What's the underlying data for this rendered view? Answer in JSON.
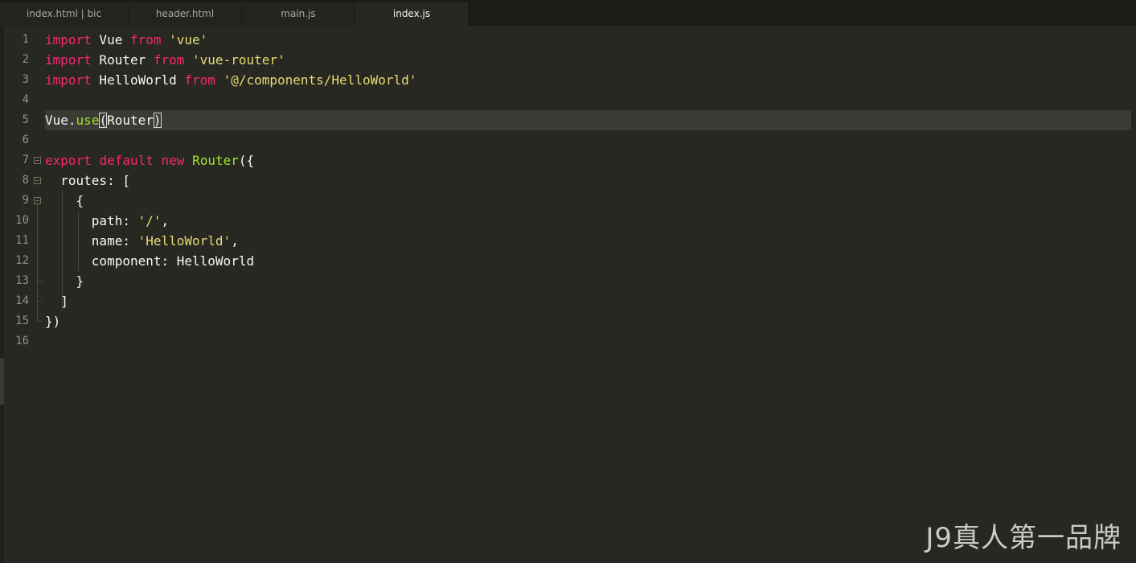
{
  "tabs": [
    {
      "label": "index.html | bic",
      "active": false
    },
    {
      "label": "header.html",
      "active": false
    },
    {
      "label": "main.js",
      "active": false
    },
    {
      "label": "index.js",
      "active": true
    }
  ],
  "line_numbers": [
    "1",
    "2",
    "3",
    "4",
    "5",
    "6",
    "7",
    "8",
    "9",
    "10",
    "11",
    "12",
    "13",
    "14",
    "15",
    "16"
  ],
  "code": {
    "l1": {
      "kw1": "import",
      "t1": " Vue ",
      "kw2": "from",
      "sp": " ",
      "str": "'vue'"
    },
    "l2": {
      "kw1": "import",
      "t1": " Router ",
      "kw2": "from",
      "sp": " ",
      "str": "'vue-router'"
    },
    "l3": {
      "kw1": "import",
      "t1": " HelloWorld ",
      "kw2": "from",
      "sp": " ",
      "str": "'@/components/HelloWorld'"
    },
    "l5": {
      "t1": "Vue.",
      "fn": "use",
      "open": "(",
      "arg": "Router",
      "close": ")"
    },
    "l7": {
      "kw1": "export",
      "sp1": " ",
      "kw2": "default",
      "sp2": " ",
      "kw3": "new",
      "sp3": " ",
      "fn": "Router",
      "t": "({"
    },
    "l8": {
      "t": "  routes: ["
    },
    "l9": {
      "t": "    {"
    },
    "l10": {
      "t": "      path: ",
      "str": "'/'",
      "t2": ","
    },
    "l11": {
      "t": "      name: ",
      "str": "'HelloWorld'",
      "t2": ","
    },
    "l12": {
      "t": "      component: HelloWorld"
    },
    "l13": {
      "t": "    }"
    },
    "l14": {
      "t": "  ]"
    },
    "l15": {
      "t": "})"
    }
  },
  "watermark": "J9真人第一品牌",
  "colors": {
    "background": "#272822",
    "keyword": "#f92672",
    "string": "#e6db74",
    "function": "#a6e22e",
    "text": "#f8f8f2"
  }
}
